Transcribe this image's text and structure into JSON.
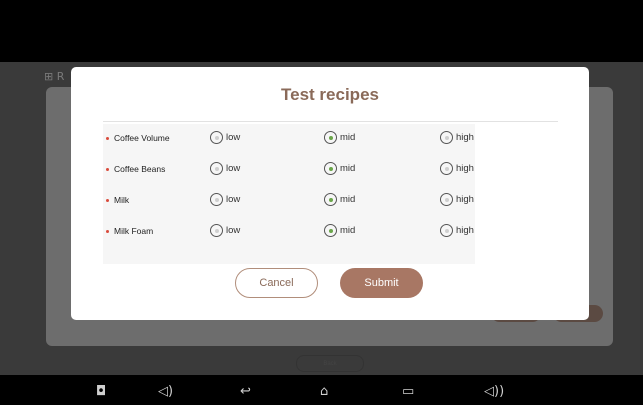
{
  "dialog": {
    "title": "Test recipes",
    "rows": [
      {
        "label": "Coffee Volume",
        "options": [
          "low",
          "mid",
          "high"
        ],
        "selected": "mid"
      },
      {
        "label": "Coffee Beans",
        "options": [
          "low",
          "mid",
          "high"
        ],
        "selected": "mid"
      },
      {
        "label": "Milk",
        "options": [
          "low",
          "mid",
          "high"
        ],
        "selected": "mid"
      },
      {
        "label": "Milk Foam",
        "options": [
          "low",
          "mid",
          "high"
        ],
        "selected": "mid"
      }
    ],
    "cancel_label": "Cancel",
    "submit_label": "Submit"
  },
  "background": {
    "back_label": "Back"
  },
  "navbar": {
    "icons": [
      "camera-icon",
      "volume-down-icon",
      "back-icon",
      "home-icon",
      "recent-apps-icon",
      "volume-up-icon"
    ]
  },
  "colors": {
    "accent": "#a87764",
    "title": "#8a6a59",
    "selected_radio": "#6aa54a",
    "bullet": "#d94b3c"
  }
}
